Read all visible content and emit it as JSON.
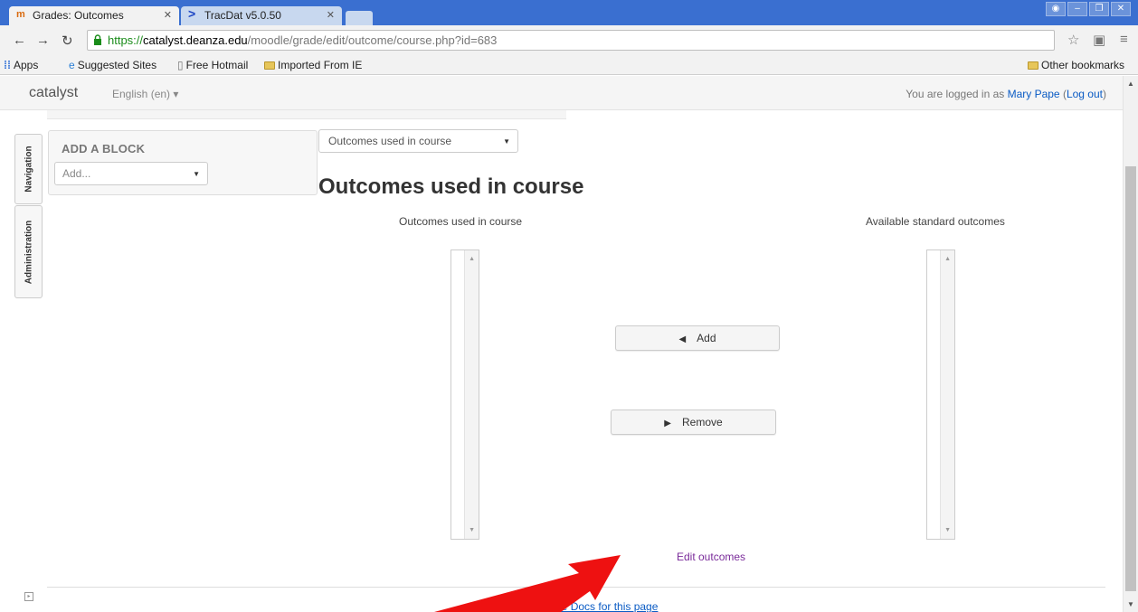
{
  "browser": {
    "tabs": [
      {
        "label": "Grades: Outcomes",
        "active": true,
        "favicon": "moodle-favicon"
      },
      {
        "label": "TracDat v5.0.50",
        "active": false,
        "favicon": "tracdat-favicon"
      }
    ],
    "url": {
      "scheme": "https://",
      "host": "catalyst.deanza.edu",
      "path": "/moodle/grade/edit/outcome/course.php?id=683"
    },
    "bookmarks": [
      {
        "label": "Apps",
        "icon": "apps-grid-icon"
      },
      {
        "label": "Suggested Sites",
        "icon": "ie-icon"
      },
      {
        "label": "Free Hotmail",
        "icon": "page-icon"
      },
      {
        "label": "Imported From IE",
        "icon": "folder-icon"
      }
    ],
    "other_bookmarks": "Other bookmarks"
  },
  "navbar": {
    "brand": "catalyst",
    "language": "English (en) ▾",
    "login_prefix": "You are logged in as ",
    "user_name": "Mary Pape",
    "logout_open": " (",
    "logout_label": "Log out",
    "logout_close": ")"
  },
  "dock": {
    "navigation": "Navigation",
    "administration": "Administration"
  },
  "add_block": {
    "title": "ADD A BLOCK",
    "select_value": "Add..."
  },
  "main": {
    "view_select": "Outcomes used in course",
    "title": "Outcomes used in course",
    "left_list_label": "Outcomes used in course",
    "right_list_label": "Available standard outcomes",
    "add_button": "Add",
    "remove_button": "Remove",
    "edit_link": "Edit outcomes",
    "docs_link": "Moodle Docs for this page"
  },
  "colors": {
    "tabstrip": "#3a6fd0",
    "link": "#0a5bc4",
    "visited_link": "#7a2b9a",
    "annotation_arrow": "#ee1111"
  }
}
